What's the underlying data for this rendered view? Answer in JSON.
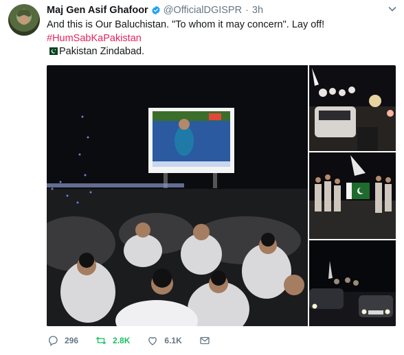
{
  "tweet": {
    "author": {
      "name": "Maj Gen Asif Ghafoor",
      "handle": "@OfficialDGISPR",
      "verified": true
    },
    "time": "3h",
    "separator": "·",
    "lines": [
      "And this is Our Baluchistan. \"To whom it may concern\". Lay off!",
      "#HumSabKaPakistan",
      "Pakistan Zindabad."
    ],
    "hashtag_color": "#e0245e",
    "media_count": 4,
    "actions": {
      "reply_count": "296",
      "retweet_count": "2.8K",
      "like_count": "6.1K"
    },
    "retweet_color": "#17bf63",
    "icons": [
      "verified-badge-icon",
      "chevron-down-icon",
      "pakistan-flag-icon",
      "reply-icon",
      "retweet-icon",
      "like-icon",
      "dm-icon"
    ]
  }
}
